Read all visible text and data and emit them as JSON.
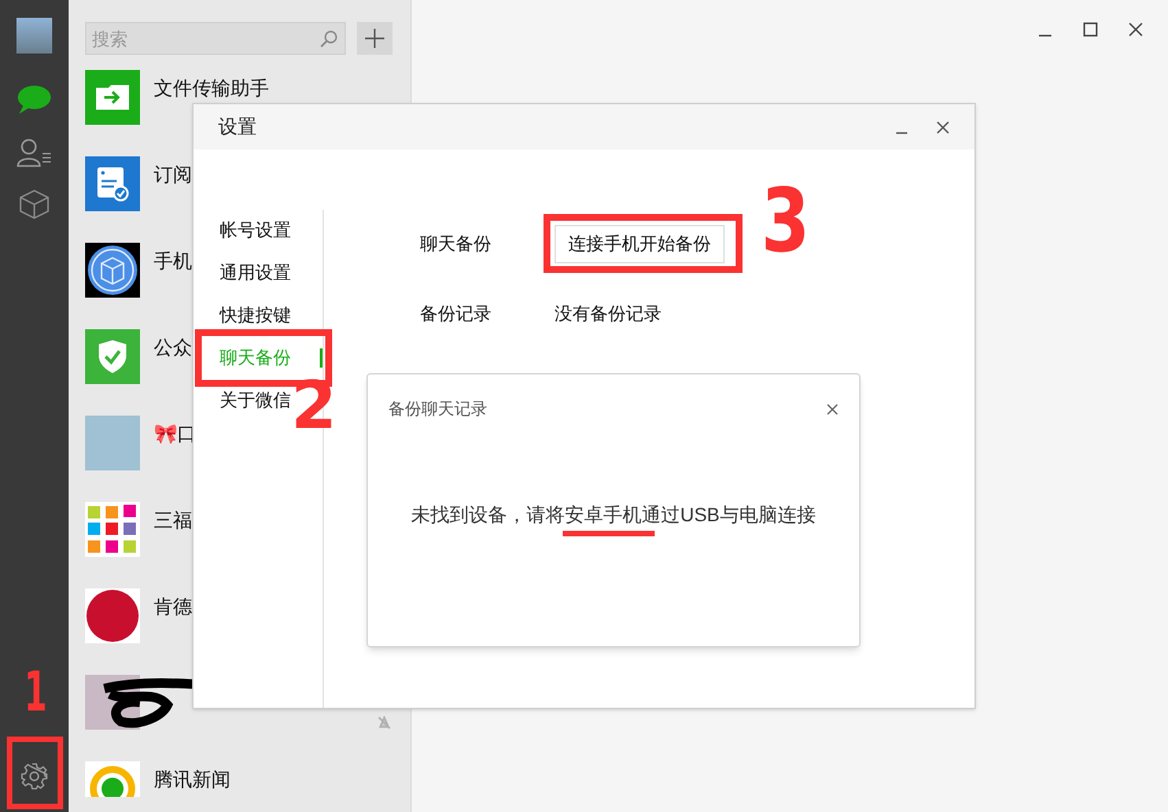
{
  "nav": [
    {
      "kind": "avatar",
      "selected": false
    },
    {
      "kind": "chats",
      "selected": true
    },
    {
      "kind": "contacts",
      "selected": false
    },
    {
      "kind": "favorites",
      "selected": false
    }
  ],
  "settings_button": {
    "selected": false
  },
  "search": {
    "placeholder": "搜索"
  },
  "chats": [
    {
      "kind": "file",
      "name": "文件传输助手",
      "muted": false
    },
    {
      "kind": "subscription",
      "name": "订阅",
      "muted": false
    },
    {
      "kind": "phone",
      "name": "手机",
      "muted": false
    },
    {
      "kind": "official",
      "name": "公众",
      "muted": false
    },
    {
      "kind": "photo",
      "name": "🎀口",
      "muted": false
    },
    {
      "kind": "tiles",
      "name": "三福",
      "muted": false
    },
    {
      "kind": "round",
      "name": "肯德",
      "muted": false
    },
    {
      "kind": "redacted",
      "muted": true
    },
    {
      "kind": "news",
      "name": "腾讯新闻",
      "muted": false
    }
  ],
  "settings": {
    "title": "设置",
    "menu": [
      {
        "label": "帐号设置",
        "selected": false
      },
      {
        "label": "通用设置",
        "selected": false
      },
      {
        "label": "快捷按键",
        "selected": false
      },
      {
        "label": "聊天备份",
        "selected": true
      },
      {
        "label": "关于微信",
        "selected": false
      }
    ],
    "rows": [
      {
        "kind": "button",
        "label": "聊天备份",
        "value": "连接手机开始备份"
      },
      {
        "kind": "text",
        "label": "备份记录",
        "value": "没有备份记录"
      }
    ]
  },
  "backup_dialog": {
    "title": "备份聊天记录",
    "message": "未找到设备，请将安卓手机通过USB与电脑连接"
  },
  "annotations": [
    {
      "text": "1"
    },
    {
      "text": "2"
    },
    {
      "text": "3"
    }
  ]
}
